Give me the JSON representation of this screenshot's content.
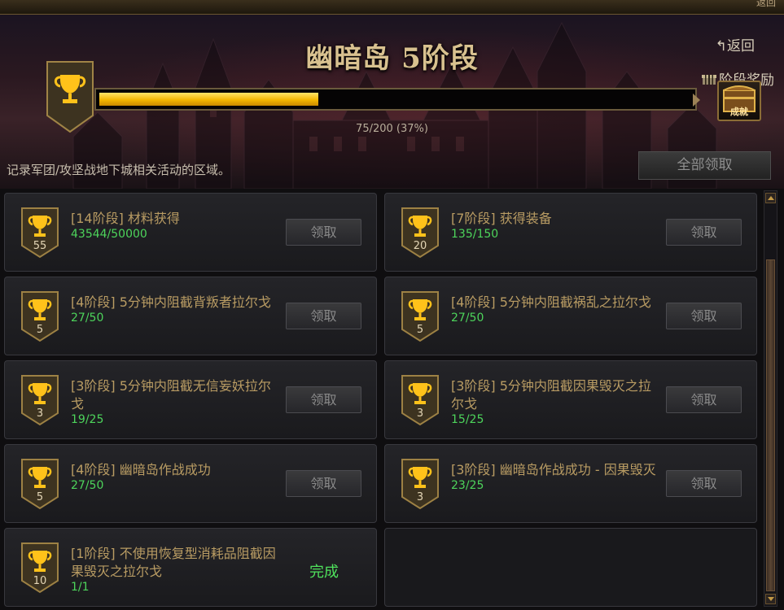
{
  "header": {
    "top_corner": "返回",
    "title": "幽暗岛 5阶段",
    "back_label": "返回",
    "stage_reward_label": "阶段奖励",
    "progress_text": "75/200 (37%)",
    "progress_fraction": 0.37,
    "chest_label": "成就",
    "subtitle": "记录军团/攻坚战地下城相关活动的区域。",
    "claim_all_label": "全部领取"
  },
  "colors": {
    "accent_gold": "#f3b600",
    "progress_green": "#4dd45b",
    "title_gold": "#d8c18f"
  },
  "achievements": [
    {
      "badge": "55",
      "name": "[14阶段] 材料获得",
      "progress": "43544/50000",
      "action": "领取"
    },
    {
      "badge": "20",
      "name": "[7阶段] 获得装备",
      "progress": "135/150",
      "action": "领取"
    },
    {
      "badge": "5",
      "name": "[4阶段] 5分钟内阻截背叛者拉尔戈",
      "progress": "27/50",
      "action": "领取"
    },
    {
      "badge": "5",
      "name": "[4阶段] 5分钟内阻截祸乱之拉尔戈",
      "progress": "27/50",
      "action": "领取"
    },
    {
      "badge": "3",
      "name": "[3阶段] 5分钟内阻截无信妄妖拉尔戈",
      "progress": "19/25",
      "action": "领取"
    },
    {
      "badge": "3",
      "name": "[3阶段] 5分钟内阻截因果毁灭之拉尔戈",
      "progress": "15/25",
      "action": "领取"
    },
    {
      "badge": "5",
      "name": "[4阶段] 幽暗岛作战成功",
      "progress": "27/50",
      "action": "领取"
    },
    {
      "badge": "3",
      "name": "[3阶段] 幽暗岛作战成功 - 因果毁灭",
      "progress": "23/25",
      "action": "领取"
    },
    {
      "badge": "10",
      "name": "[1阶段] 不使用恢复型消耗品阻截因果毁灭之拉尔戈",
      "progress": "1/1",
      "action": "完成"
    }
  ]
}
